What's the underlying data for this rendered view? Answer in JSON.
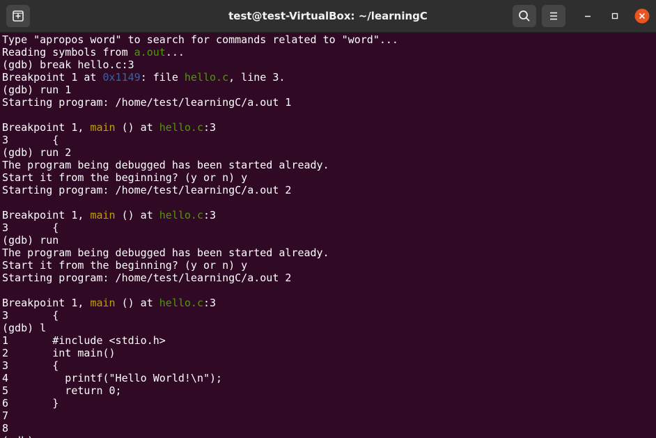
{
  "window": {
    "title": "test@test-VirtualBox: ~/learningC"
  },
  "icons": {
    "new_tab": "new-tab-icon",
    "search": "search-icon",
    "menu": "hamburger-menu-icon",
    "minimize": "minimize-icon",
    "maximize": "maximize-icon",
    "close": "close-icon"
  },
  "colors": {
    "terminal_bg": "#300a24",
    "titlebar_bg": "#2f2f2f",
    "text": "#ffffff",
    "green": "#4e9a06",
    "blue": "#3465a4",
    "yellow": "#c4a000",
    "close_button": "#e95420"
  },
  "terminal": {
    "lines": [
      [
        {
          "t": "Type \"apropos word\" to search for commands related to \"word\"..."
        }
      ],
      [
        {
          "t": "Reading symbols from "
        },
        {
          "t": "a.out",
          "c": "green"
        },
        {
          "t": "..."
        }
      ],
      [
        {
          "t": "(gdb) break hello.c:3"
        }
      ],
      [
        {
          "t": "Breakpoint 1 at "
        },
        {
          "t": "0x1149",
          "c": "blue"
        },
        {
          "t": ": file "
        },
        {
          "t": "hello.c",
          "c": "green"
        },
        {
          "t": ", line 3."
        }
      ],
      [
        {
          "t": "(gdb) run 1"
        }
      ],
      [
        {
          "t": "Starting program: /home/test/learningC/a.out 1"
        }
      ],
      [],
      [
        {
          "t": "Breakpoint 1, "
        },
        {
          "t": "main",
          "c": "yellow"
        },
        {
          "t": " () at "
        },
        {
          "t": "hello.c",
          "c": "green"
        },
        {
          "t": ":3"
        }
      ],
      [
        {
          "t": "3       {"
        }
      ],
      [
        {
          "t": "(gdb) run 2"
        }
      ],
      [
        {
          "t": "The program being debugged has been started already."
        }
      ],
      [
        {
          "t": "Start it from the beginning? (y or n) y"
        }
      ],
      [
        {
          "t": "Starting program: /home/test/learningC/a.out 2"
        }
      ],
      [],
      [
        {
          "t": "Breakpoint 1, "
        },
        {
          "t": "main",
          "c": "yellow"
        },
        {
          "t": " () at "
        },
        {
          "t": "hello.c",
          "c": "green"
        },
        {
          "t": ":3"
        }
      ],
      [
        {
          "t": "3       {"
        }
      ],
      [
        {
          "t": "(gdb) run"
        }
      ],
      [
        {
          "t": "The program being debugged has been started already."
        }
      ],
      [
        {
          "t": "Start it from the beginning? (y or n) y"
        }
      ],
      [
        {
          "t": "Starting program: /home/test/learningC/a.out 2"
        }
      ],
      [],
      [
        {
          "t": "Breakpoint 1, "
        },
        {
          "t": "main",
          "c": "yellow"
        },
        {
          "t": " () at "
        },
        {
          "t": "hello.c",
          "c": "green"
        },
        {
          "t": ":3"
        }
      ],
      [
        {
          "t": "3       {"
        }
      ],
      [
        {
          "t": "(gdb) l"
        }
      ],
      [
        {
          "t": "1       #include <stdio.h>"
        }
      ],
      [
        {
          "t": "2       int main()"
        }
      ],
      [
        {
          "t": "3       {"
        }
      ],
      [
        {
          "t": "4         printf(\"Hello World!\\n\");"
        }
      ],
      [
        {
          "t": "5         return 0;"
        }
      ],
      [
        {
          "t": "6       }"
        }
      ],
      [
        {
          "t": "7"
        }
      ],
      [
        {
          "t": "8"
        }
      ],
      [
        {
          "t": "(gdb) "
        }
      ]
    ]
  }
}
